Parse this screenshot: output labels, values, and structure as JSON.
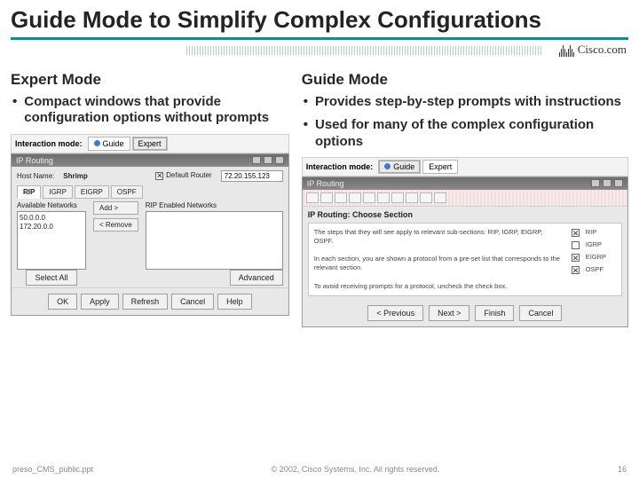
{
  "title": "Guide Mode to Simplify Complex Configurations",
  "logo": "Cisco.com",
  "left": {
    "heading": "Expert Mode",
    "bullets": [
      "Compact windows that provide configuration options without prompts"
    ]
  },
  "right": {
    "heading": "Guide Mode",
    "bullets": [
      "Provides step-by-step prompts with instructions",
      "Used for many of the complex configuration options"
    ]
  },
  "modebar": {
    "label": "Interaction mode:",
    "guide": "Guide",
    "expert": "Expert"
  },
  "expert": {
    "winTitle": "IP Routing",
    "hostLabel": "Host Name:",
    "hostValue": "Shrimp",
    "defLabel": "Default Router",
    "defValue": "72.20.155.123",
    "tabs": [
      "RIP",
      "IGRP",
      "EIGRP",
      "OSPF"
    ],
    "leftLabel": "Available Networks",
    "leftItems": [
      "50.0.0.0",
      "172.20.0.0"
    ],
    "rightLabel": "RIP Enabled Networks",
    "addBtn": "Add >",
    "remBtn": "< Remove",
    "selectAll": "Select All",
    "advanced": "Advanced",
    "bottom": [
      "OK",
      "Apply",
      "Refresh",
      "Cancel",
      "Help"
    ]
  },
  "guide": {
    "winTitle": "IP Routing",
    "section": "IP Routing: Choose Section",
    "p1": "The steps that they will see apply to relevant sub-sections: RIP, IGRP, EIGRP, OSPF.",
    "p2": "In each section, you are shown a protocol from a pre-set list that corresponds to the relevant section.",
    "p3": "To avoid receiving prompts for a protocol, uncheck the check box.",
    "opts": [
      "RIP",
      "IGRP",
      "EIGRP",
      "OSPF"
    ],
    "buttons": [
      "< Previous",
      "Next >",
      "Finish",
      "Cancel"
    ]
  },
  "footer": {
    "file": "preso_CMS_public.ppt",
    "copyright": "© 2002, Cisco Systems, Inc. All rights reserved.",
    "page": "16"
  }
}
